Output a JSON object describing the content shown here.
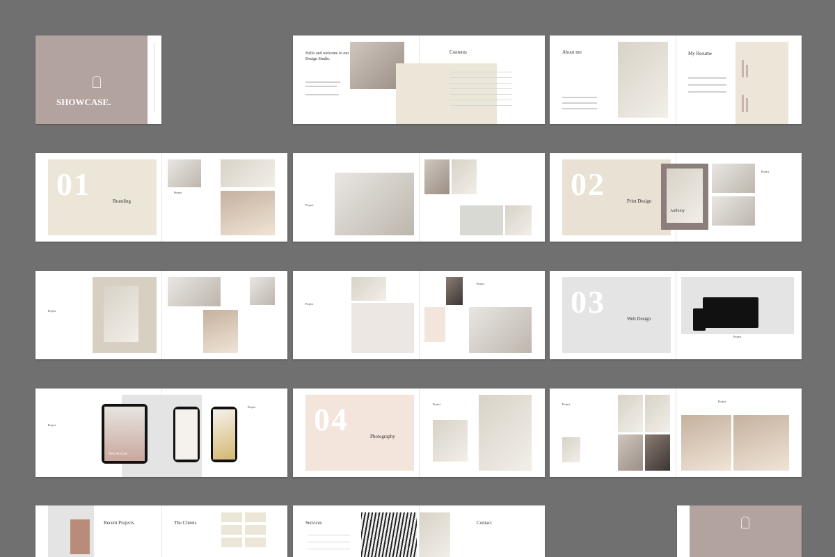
{
  "cover": {
    "title": "SHOWCASE."
  },
  "intro": {
    "welcome": "Hello and welcome to our Design Studio.",
    "contents_title": "Contents"
  },
  "about": {
    "title": "About me",
    "resume": "My Resume"
  },
  "sections": [
    {
      "num": "01",
      "name": "Branding"
    },
    {
      "num": "02",
      "name": "Print Design"
    },
    {
      "num": "03",
      "name": "Web Design"
    },
    {
      "num": "04",
      "name": "Photography"
    }
  ],
  "labels": {
    "project": "Project",
    "recent": "Recent Projects",
    "clients": "The Clients",
    "services": "Services",
    "contact": "Contact",
    "new_arrivals": "New Arrivals",
    "anthony": "Anthony"
  }
}
